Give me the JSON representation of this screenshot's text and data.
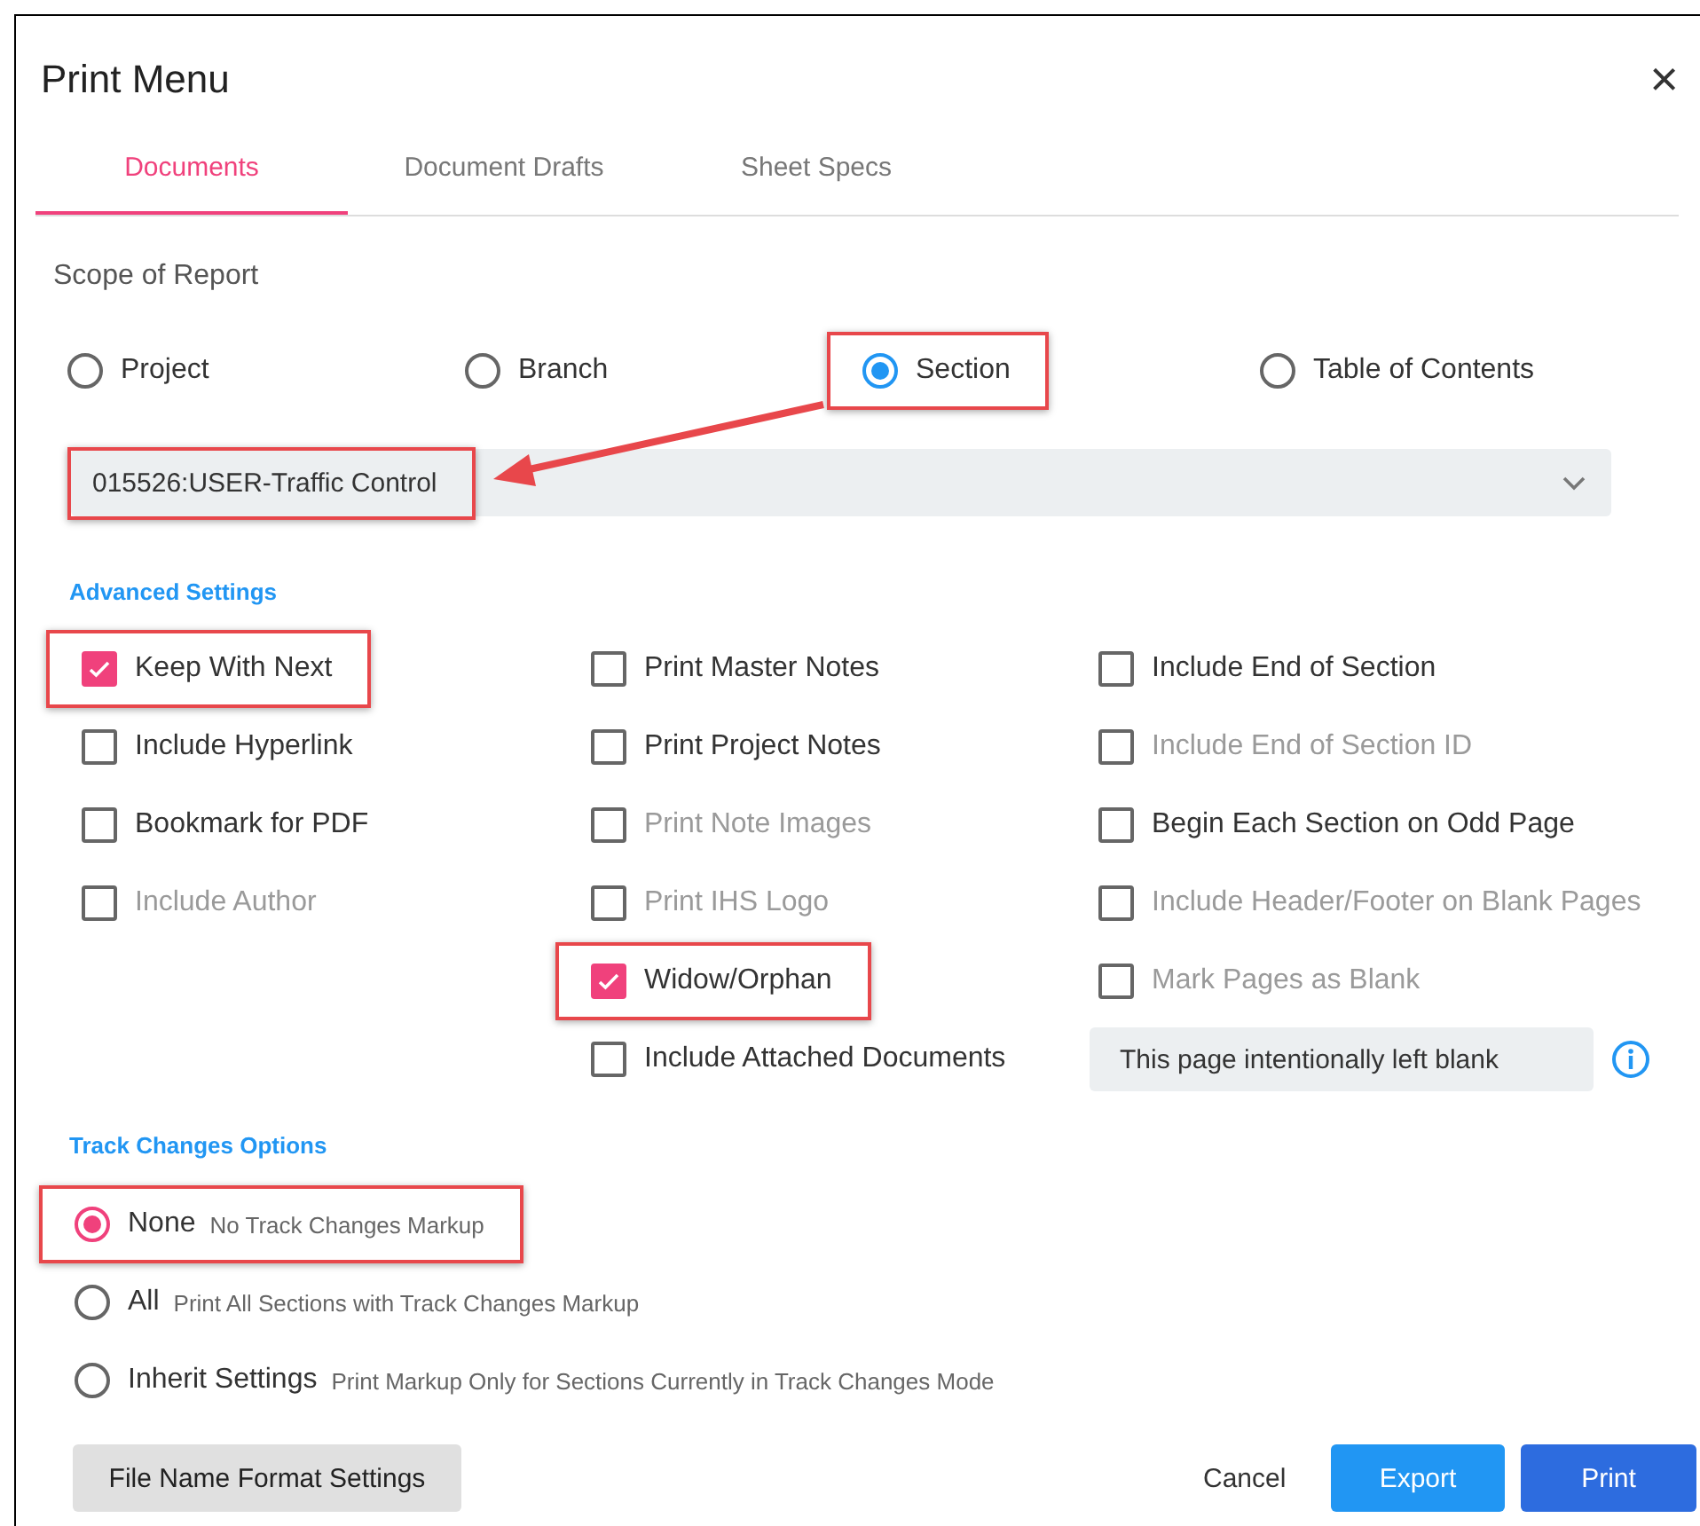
{
  "dialog": {
    "title": "Print Menu",
    "close": "×"
  },
  "tabs": [
    {
      "label": "Documents",
      "selected": true
    },
    {
      "label": "Document Drafts",
      "selected": false
    },
    {
      "label": "Sheet Specs",
      "selected": false
    }
  ],
  "scope": {
    "heading": "Scope of Report",
    "options": [
      {
        "label": "Project",
        "selected": false,
        "highlighted": false
      },
      {
        "label": "Branch",
        "selected": false,
        "highlighted": false
      },
      {
        "label": "Section",
        "selected": true,
        "highlighted": true
      },
      {
        "label": "Table of Contents",
        "selected": false,
        "highlighted": false
      }
    ]
  },
  "section_dropdown": {
    "value": "015526:USER-Traffic Control",
    "highlighted": true
  },
  "annotation_arrow": true,
  "advanced_settings": {
    "heading": "Advanced Settings",
    "columns": [
      {
        "items": [
          {
            "kind": "checkbox",
            "label": "Keep With Next",
            "checked": true,
            "disabled": false,
            "highlighted": true
          },
          {
            "kind": "checkbox",
            "label": "Include Hyperlink",
            "checked": false,
            "disabled": false,
            "highlighted": false
          },
          {
            "kind": "checkbox",
            "label": "Bookmark for PDF",
            "checked": false,
            "disabled": false,
            "highlighted": false
          },
          {
            "kind": "checkbox",
            "label": "Include Author",
            "checked": false,
            "disabled": true,
            "highlighted": false
          }
        ]
      },
      {
        "items": [
          {
            "kind": "checkbox",
            "label": "Print Master Notes",
            "checked": false,
            "disabled": false,
            "highlighted": false
          },
          {
            "kind": "checkbox",
            "label": "Print Project Notes",
            "checked": false,
            "disabled": false,
            "highlighted": false
          },
          {
            "kind": "checkbox",
            "label": "Print Note Images",
            "checked": false,
            "disabled": true,
            "highlighted": false
          },
          {
            "kind": "checkbox",
            "label": "Print IHS Logo",
            "checked": false,
            "disabled": true,
            "highlighted": false
          },
          {
            "kind": "checkbox",
            "label": "Widow/Orphan",
            "checked": true,
            "disabled": false,
            "highlighted": true
          },
          {
            "kind": "checkbox",
            "label": "Include Attached Documents",
            "checked": false,
            "disabled": false,
            "highlighted": false
          }
        ]
      },
      {
        "items": [
          {
            "kind": "checkbox",
            "label": "Include End of Section",
            "checked": false,
            "disabled": false,
            "highlighted": false
          },
          {
            "kind": "checkbox",
            "label": "Include End of Section ID",
            "checked": false,
            "disabled": true,
            "highlighted": false
          },
          {
            "kind": "checkbox",
            "label": "Begin Each Section on Odd Page",
            "checked": false,
            "disabled": false,
            "highlighted": false
          },
          {
            "kind": "checkbox",
            "label": "Include Header/Footer on Blank Pages",
            "checked": false,
            "disabled": true,
            "highlighted": false
          },
          {
            "kind": "checkbox",
            "label": "Mark Pages as Blank",
            "checked": false,
            "disabled": true,
            "highlighted": false
          },
          {
            "kind": "field",
            "value": "This page intentionally left blank"
          }
        ]
      }
    ]
  },
  "track_changes": {
    "heading": "Track Changes Options",
    "options": [
      {
        "label": "None",
        "description": "No Track Changes Markup",
        "selected": true,
        "highlighted": true
      },
      {
        "label": "All",
        "description": "Print All Sections with Track Changes Markup",
        "selected": false,
        "highlighted": false
      },
      {
        "label": "Inherit Settings",
        "description": "Print Markup Only for Sections Currently in Track Changes Mode",
        "selected": false,
        "highlighted": false
      }
    ]
  },
  "buttons": [
    {
      "label": "File Name Format Settings",
      "kind": "secondary"
    },
    {
      "label": "Cancel",
      "kind": "text"
    },
    {
      "label": "Export",
      "kind": "primary"
    },
    {
      "label": "Print",
      "kind": "strong"
    }
  ]
}
